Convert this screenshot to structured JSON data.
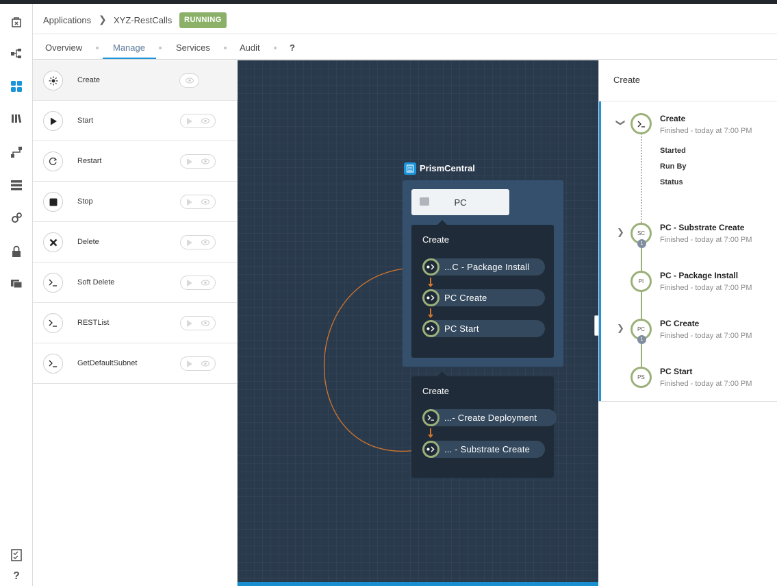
{
  "breadcrumb": {
    "applications": "Applications",
    "app_name": "XYZ-RestCalls",
    "status": "RUNNING"
  },
  "tabs": [
    {
      "label": "Overview"
    },
    {
      "label": "Manage"
    },
    {
      "label": "Services"
    },
    {
      "label": "Audit"
    },
    {
      "label": "?"
    }
  ],
  "actions": [
    {
      "label": "Create",
      "icon": "sun-icon"
    },
    {
      "label": "Start",
      "icon": "play-icon"
    },
    {
      "label": "Restart",
      "icon": "refresh-icon"
    },
    {
      "label": "Stop",
      "icon": "stop-icon"
    },
    {
      "label": "Delete",
      "icon": "x-icon"
    },
    {
      "label": "Soft Delete",
      "icon": "terminal-icon"
    },
    {
      "label": "RESTList",
      "icon": "terminal-icon"
    },
    {
      "label": "GetDefaultSubnet",
      "icon": "terminal-icon"
    }
  ],
  "canvas": {
    "service_name": "PrismCentral",
    "substrate_label": "PC",
    "flow1": {
      "title": "Create",
      "tasks": [
        "...C - Package Install",
        "PC Create",
        "PC Start"
      ]
    },
    "flow2": {
      "title": "Create",
      "tasks": [
        "...- Create Deployment",
        "... - Substrate Create"
      ]
    }
  },
  "right_panel": {
    "title": "Create",
    "root": {
      "title": "Create",
      "subtitle": "Finished - today at 7:00 PM",
      "details": [
        "Started",
        "Run By",
        "Status"
      ]
    },
    "tasks": [
      {
        "abbr": "SC",
        "title": "PC - Substrate Create",
        "subtitle": "Finished - today at 7:00 PM",
        "badge": "1"
      },
      {
        "abbr": "PI",
        "title": "PC - Package Install",
        "subtitle": "Finished - today at 7:00 PM"
      },
      {
        "abbr": "PC",
        "title": "PC Create",
        "subtitle": "Finished - today at 7:00 PM",
        "badge": "1"
      },
      {
        "abbr": "PS",
        "title": "PC Start",
        "subtitle": "Finished - today at 7:00 PM"
      }
    ]
  },
  "colors": {
    "accent": "#1b95d9",
    "status_running": "#8bb168",
    "node_ring": "#9cb07a",
    "edge": "#d4772c",
    "canvas_bg": "#2a3a4d"
  }
}
